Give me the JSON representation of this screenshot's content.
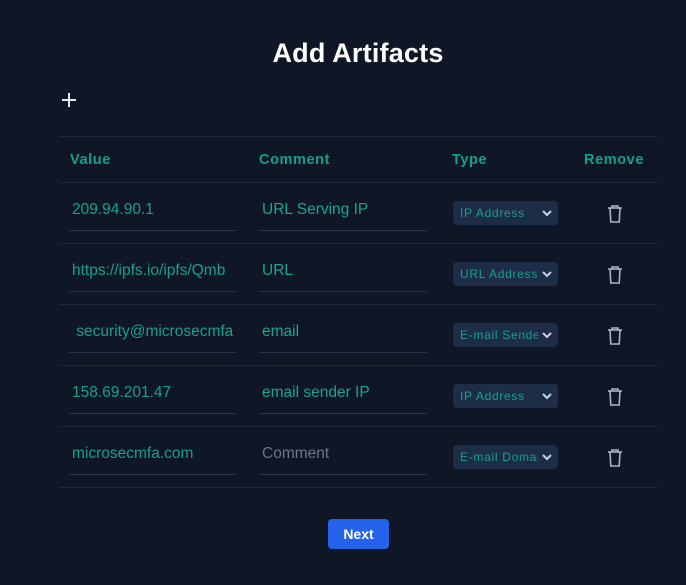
{
  "page": {
    "title": "Add Artifacts",
    "next_label": "Next",
    "accent_color": "#14a08a",
    "button_color": "#2563eb",
    "background_color": "#0f1727"
  },
  "add_button": {
    "icon": "plus-icon"
  },
  "table": {
    "headers": {
      "value": "Value",
      "comment": "Comment",
      "type": "Type",
      "remove": "Remove"
    },
    "rows": [
      {
        "value": "209.94.90.1",
        "comment": "URL Serving IP",
        "comment_placeholder": "Comment",
        "type": "IP Address"
      },
      {
        "value": "https://ipfs.io/ipfs/Qmb",
        "comment": "URL",
        "comment_placeholder": "Comment",
        "type": "URL Address"
      },
      {
        "value": " security@microsecmfa",
        "comment": "email",
        "comment_placeholder": "Comment",
        "type": "E-mail Sender"
      },
      {
        "value": "158.69.201.47",
        "comment": "email sender IP",
        "comment_placeholder": "Comment",
        "type": "IP Address"
      },
      {
        "value": "microsecmfa.com",
        "comment": "",
        "comment_placeholder": "Comment",
        "type": "E-mail Domain"
      }
    ]
  }
}
